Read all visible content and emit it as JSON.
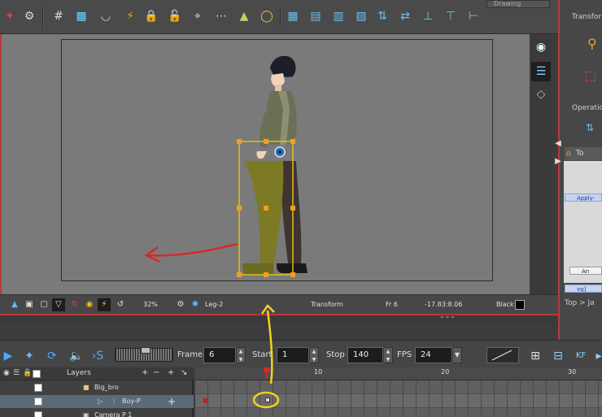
{
  "top_toolbar": {
    "drawing_tab_label": "Drawing",
    "icons": [
      "snap-icon",
      "settings-gear-icon",
      "grid-icon",
      "camera-mask-icon",
      "onion-skin-icon",
      "lock-icon",
      "lock-plus-icon",
      "bone-icon",
      "dotted-line-icon",
      "deform-icon",
      "pocket-watch-icon",
      "pivot-icon",
      "distribute-icon",
      "align-icon",
      "align-alt-icon",
      "center-icon"
    ]
  },
  "status_bar": {
    "zoom": "32%",
    "selected_element": "Leg-2",
    "tool": "Transform",
    "frame": "Fr 6",
    "coordinates": "-17.83:8.06",
    "color_name": "Black"
  },
  "right_panel": {
    "transform_label": "Transfor",
    "operation_label": "Operatio",
    "node_tab_label": "To",
    "node_apply": "Apply-",
    "node_second": "An",
    "node_vg": "vg]",
    "breadcrumb_top": "Top",
    "breadcrumb_sep": ">",
    "breadcrumb_next": "Ja"
  },
  "timeline_toolbar": {
    "frame_label": "Frame",
    "frame_value": "6",
    "start_label": "Start",
    "start_value": "1",
    "stop_label": "Stop",
    "stop_value": "140",
    "fps_label": "FPS",
    "fps_value": "24",
    "sound_label": "S",
    "kf_label": "KF"
  },
  "layers": {
    "header_label": "Layers",
    "header_buttons": [
      "+",
      "−",
      "+",
      "↘"
    ],
    "rows": [
      {
        "name": "Big_bro",
        "selected": false
      },
      {
        "name": "Boy-P",
        "selected": true
      },
      {
        "name": "Camera P 1",
        "selected": false
      }
    ]
  },
  "timeline": {
    "tick_labels": [
      "10",
      "20",
      "30"
    ],
    "current_frame": 6
  },
  "colors": {
    "accent_red": "#d42a2a",
    "annotation_yellow": "#f2d21f",
    "selection_box": "#e0c020",
    "focus_blue": "#4ea6ff"
  }
}
